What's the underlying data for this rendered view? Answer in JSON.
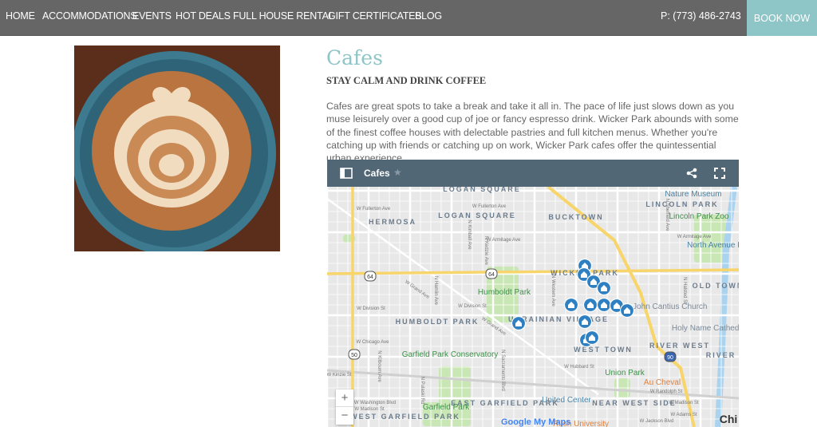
{
  "nav": {
    "items": [
      "HOME",
      "ACCOMMODATIONS",
      "EVENTS",
      "HOT DEALS",
      "FULL HOUSE RENTAL",
      "GIFT CERTIFICATES",
      "BLOG"
    ],
    "phone": "P: (773) 486-2743",
    "book": "BOOK NOW"
  },
  "page": {
    "title": "Cafes",
    "subtitle": "STAY CALM AND DRINK COFFEE",
    "description": "Cafes are great spots to take a break and take it all in.  The pace of life just slows down as you muse leisurely over a good cup of joe or fancy espresso drink.  Wicker Park abounds with some of the finest coffee houses with delectable pastries and full kitchen menus.  Whether you're catching up with friends or catching up on work, Wicker Park cafes offer the quintessential urban experience."
  },
  "map": {
    "title": "Cafes",
    "zoom_in": "+",
    "zoom_out": "−",
    "attribution": "Google My Maps",
    "marker_color": "#2f80c2",
    "neighborhoods": [
      "LOGAN SQUARE",
      "HERMOSA",
      "BUCKTOWN",
      "LINCOLN PARK",
      "WICKER PARK",
      "OLD TOWN",
      "HUMBOLDT PARK",
      "UKRAINIAN VILLAGE",
      "WEST TOWN",
      "RIVER WEST",
      "RIVER N",
      "EAST GARFIELD PARK",
      "NEAR WEST SIDE",
      "WEST GARFIELD PARK"
    ],
    "places": [
      "Nature Museum",
      "Lincoln Park Zoo",
      "North Avenue B",
      "Humboldt Park",
      "Saint John Cantius Church",
      "Holy Name Cathedral Pari",
      "Garfield Park Conservatory",
      "Union Park",
      "Au Cheval",
      "United Center",
      "Garfield Park",
      "Rush University",
      "Chi"
    ],
    "streets": [
      "W Fullerton Ave",
      "W Fullerton Ave",
      "W Armitage Ave",
      "W Armitage Ave",
      "W Grand Ave",
      "W Division St",
      "W Division St",
      "W Chicago Ave",
      "W Hubbard St",
      "W Kinzie St",
      "W Randolph St",
      "W Madison St",
      "W Washington Blvd",
      "W Madison St",
      "W Adams St",
      "W Jackson Blvd",
      "N Kimball Ave",
      "N Kedzie Ave",
      "N Western Ave",
      "N Sheffield Ave",
      "N Halsted St",
      "N Hamlin Ave",
      "N Pulaski Rd",
      "N Sacramento Blvd",
      "N Kilbourn Ave",
      "W Kinzie St"
    ],
    "shields": [
      "64",
      "64",
      "50",
      "90"
    ]
  }
}
